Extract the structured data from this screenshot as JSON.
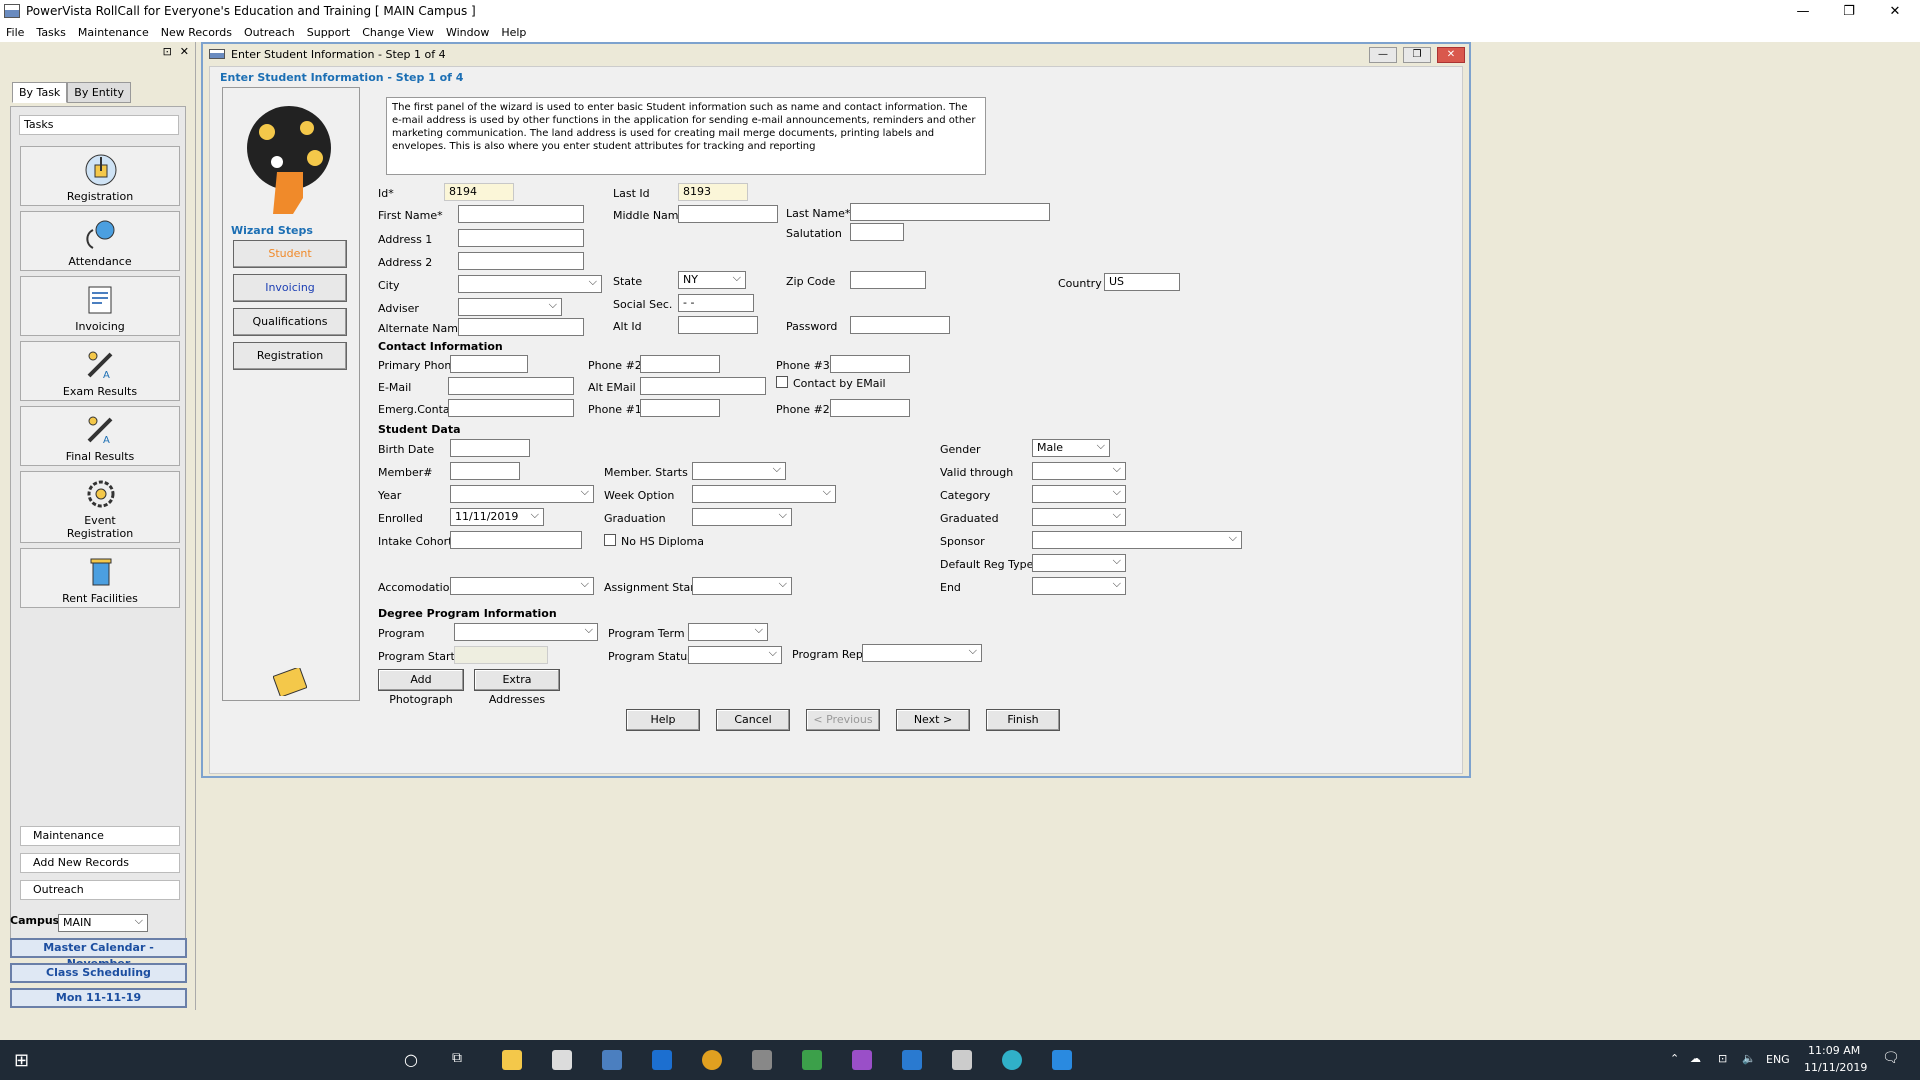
{
  "window": {
    "title": "PowerVista RollCall for Everyone's Education and Training   [ MAIN Campus ]"
  },
  "menu": [
    "File",
    "Tasks",
    "Maintenance",
    "New Records",
    "Outreach",
    "Support",
    "Change View",
    "Window",
    "Help"
  ],
  "left": {
    "tabs": [
      "By Task",
      "By Entity"
    ],
    "tasks_header": "Tasks",
    "tasks": [
      "Registration",
      "Attendance",
      "Invoicing",
      "Exam Results",
      "Final Results",
      "Event Registration",
      "Rent Facilities"
    ],
    "bottom": [
      "Maintenance",
      "Add New Records",
      "Outreach"
    ],
    "campus_label": "Campus",
    "campus_value": "MAIN",
    "links": [
      "Master Calendar - November",
      "Class Scheduling",
      "Mon 11-11-19"
    ]
  },
  "dialog": {
    "title": "Enter Student Information - Step 1 of 4",
    "heading": "Enter Student Information - Step 1 of 4",
    "wizard_steps_label": "Wizard Steps",
    "steps": [
      "Student",
      "Invoicing",
      "Qualifications",
      "Registration"
    ],
    "description": "The first panel of the wizard is used to enter basic Student information such as name and contact information. The e-mail address is used by other functions in the application for sending e-mail announcements, reminders and other marketing communication. The land address is used for creating mail merge documents, printing labels and envelopes. This is also where you enter student attributes for tracking and reporting",
    "labels": {
      "id": "Id*",
      "last_id": "Last Id",
      "first_name": "First Name*",
      "middle_name": "Middle Name",
      "last_name": "Last Name*",
      "salutation": "Salutation",
      "address1": "Address 1",
      "address2": "Address 2",
      "city": "City",
      "state": "State",
      "zip": "Zip Code",
      "country": "Country",
      "adviser": "Adviser",
      "social": "Social Sec.",
      "alternate": "Alternate Name",
      "alt_id": "Alt Id",
      "password": "Password",
      "contact_info": "Contact Information",
      "primary_phone": "Primary Phone",
      "phone2": "Phone #2",
      "phone3": "Phone #3",
      "email": "E-Mail",
      "alt_email": "Alt EMail",
      "contact_by_email": "Contact by EMail",
      "emerg": "Emerg.Contact",
      "phone1": "Phone #1",
      "phone2b": "Phone #2",
      "student_data": "Student Data",
      "birth": "Birth Date",
      "gender": "Gender",
      "member": "Member#",
      "member_starts": "Member. Starts",
      "valid": "Valid through",
      "year": "Year",
      "week_option": "Week Option",
      "category": "Category",
      "enrolled": "Enrolled",
      "graduation": "Graduation",
      "graduated": "Graduated",
      "intake": "Intake Cohort",
      "no_hs": "No HS Diploma",
      "sponsor": "Sponsor",
      "default_reg": "Default Reg Type",
      "accom": "Accomodation",
      "assign_start": "Assignment Start",
      "end": "End",
      "degree": "Degree Program Information",
      "program": "Program",
      "program_term": "Program Term",
      "program_starts": "Program Starts",
      "program_status": "Program Status",
      "program_rep": "Program Rep"
    },
    "values": {
      "id": "8194",
      "last_id": "8193",
      "state": "NY",
      "country": "US",
      "social": " -  -",
      "gender": "Male",
      "enrolled": "11/11/2019"
    },
    "buttons": {
      "add_photo": "Add Photograph",
      "extra_addr": "Extra Addresses",
      "help": "Help",
      "cancel": "Cancel",
      "previous": "< Previous",
      "next": "Next >",
      "finish": "Finish"
    }
  },
  "taskbar": {
    "lang": "ENG",
    "time": "11:09 AM",
    "date": "11/11/2019"
  }
}
